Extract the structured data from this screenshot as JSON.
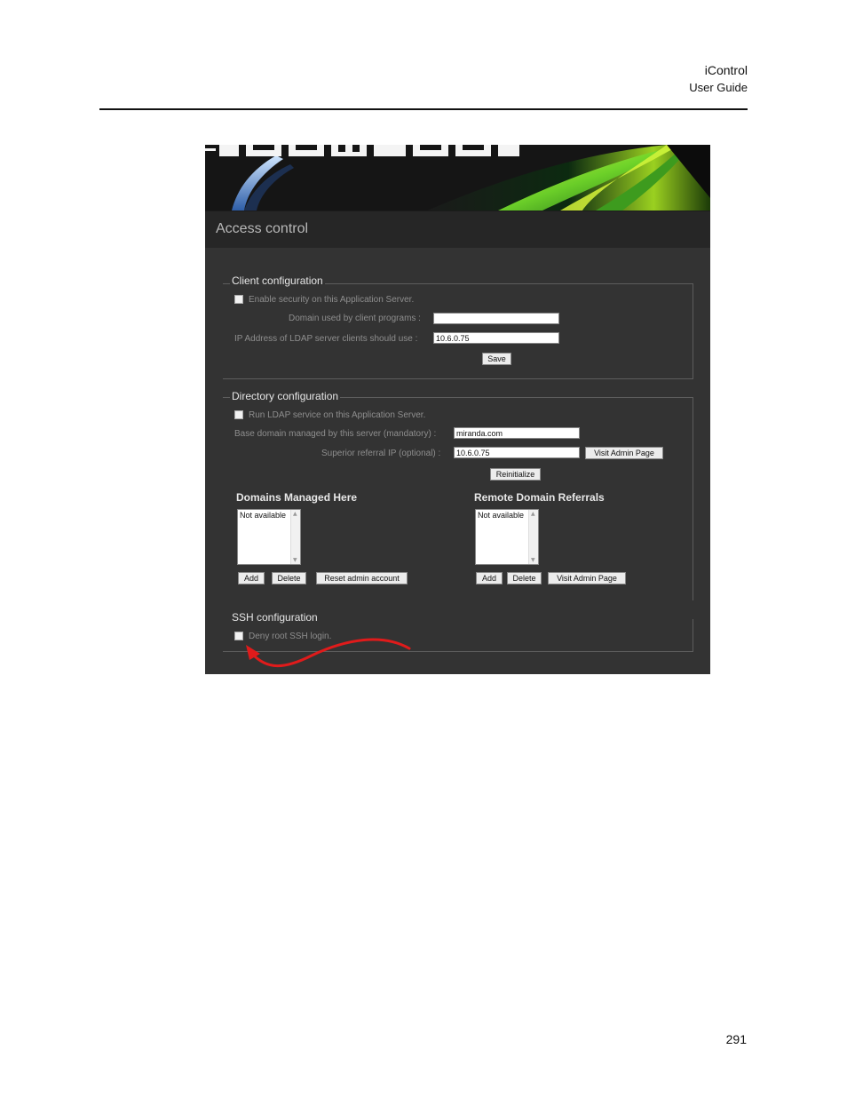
{
  "document": {
    "title": "iControl",
    "subtitle": "User Guide",
    "page_number": "291"
  },
  "app": {
    "banner_logo_text": "ICONTROL",
    "page_title": "Access control"
  },
  "client_configuration": {
    "legend": "Client configuration",
    "enable_security_label": "Enable security on this Application Server.",
    "enable_security_checked": false,
    "domain_label": "Domain used by client programs :",
    "domain_value": "",
    "ldap_ip_label": "IP Address of LDAP server clients should use :",
    "ldap_ip_value": "10.6.0.75",
    "save_label": "Save"
  },
  "directory_configuration": {
    "legend": "Directory configuration",
    "run_ldap_label": "Run LDAP service on this Application Server.",
    "run_ldap_checked": false,
    "base_domain_label": "Base domain managed by this server (mandatory) :",
    "base_domain_value": "miranda.com",
    "superior_ip_label": "Superior referral IP (optional) :",
    "superior_ip_value": "10.6.0.75",
    "visit_admin_label": "Visit Admin Page",
    "reinitialize_label": "Reinitialize",
    "domains_managed": {
      "heading": "Domains Managed Here",
      "items": [
        "Not available"
      ],
      "add_label": "Add",
      "delete_label": "Delete",
      "reset_label": "Reset admin account"
    },
    "remote_referrals": {
      "heading": "Remote Domain Referrals",
      "items": [
        "Not available"
      ],
      "add_label": "Add",
      "delete_label": "Delete",
      "visit_label": "Visit Admin Page"
    }
  },
  "ssh_configuration": {
    "legend": "SSH configuration",
    "deny_root_label": "Deny root SSH login.",
    "deny_root_checked": false
  },
  "colors": {
    "panel_bg": "#333333",
    "title_bar_bg": "#262626",
    "annotation_arrow": "#e01b1b"
  }
}
